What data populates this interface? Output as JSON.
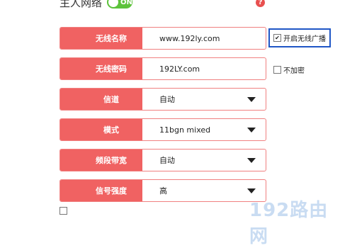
{
  "header": {
    "title": "主人网络",
    "toggle_label": "ON",
    "help_label": "?"
  },
  "rows": [
    {
      "label": "无线名称",
      "value": "www.192ly.com",
      "dropdown": false
    },
    {
      "label": "无线密码",
      "value": "192LY.com",
      "dropdown": false
    },
    {
      "label": "信道",
      "value": "自动",
      "dropdown": true
    },
    {
      "label": "模式",
      "value": "11bgn mixed",
      "dropdown": true
    },
    {
      "label": "频段带宽",
      "value": "自动",
      "dropdown": true
    },
    {
      "label": "信号强度",
      "value": "高",
      "dropdown": true
    }
  ],
  "options": {
    "broadcast": {
      "label": "开启无线广播",
      "checked": true,
      "mark": "✔"
    },
    "no_encrypt": {
      "label": "不加密",
      "checked": false
    }
  },
  "watermark": {
    "text": "192路由网"
  },
  "colors": {
    "accent": "#f06262",
    "toggle_on": "#5cc23a",
    "highlight_border": "#1f56c6"
  }
}
